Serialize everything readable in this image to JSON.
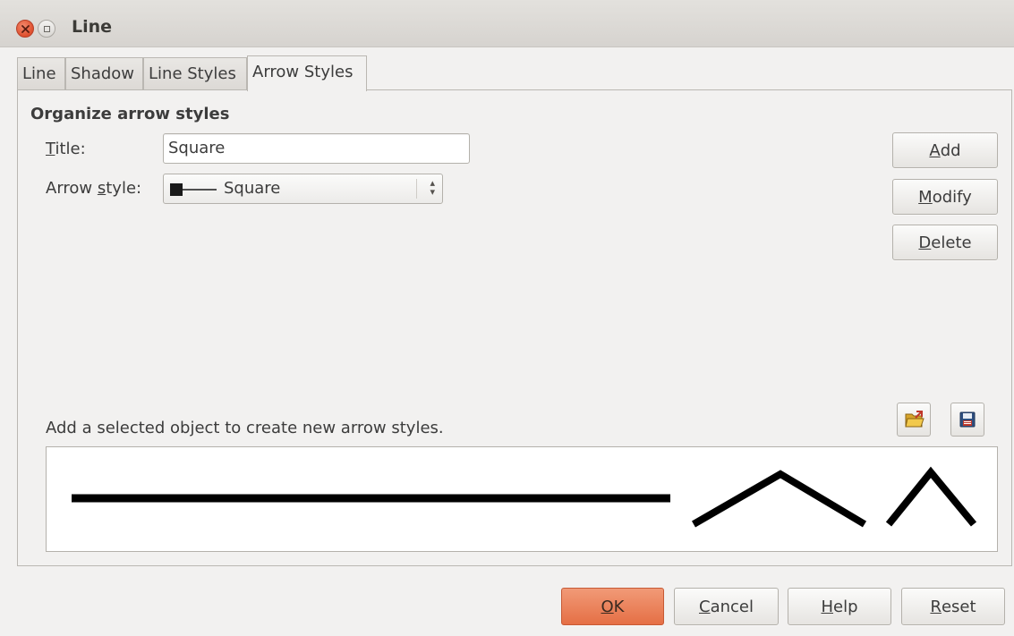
{
  "window": {
    "title": "Line"
  },
  "tabs": [
    {
      "label": "Line",
      "active": false
    },
    {
      "label": "Shadow",
      "active": false
    },
    {
      "label": "Line Styles",
      "active": false
    },
    {
      "label": "Arrow Styles",
      "active": true
    }
  ],
  "section": {
    "title": "Organize arrow styles"
  },
  "form": {
    "title_label_mnemonic": "T",
    "title_label_rest": "itle:",
    "title_value": "Square",
    "arrow_label_pre": "Arrow ",
    "arrow_label_mnemonic": "s",
    "arrow_label_rest": "tyle:",
    "arrow_style_selected": "Square"
  },
  "side_buttons": {
    "add_mnemonic": "A",
    "add_rest": "dd",
    "modify_mnemonic": "M",
    "modify_rest": "odify",
    "delete_mnemonic": "D",
    "delete_rest": "elete"
  },
  "hint_text": "Add a selected object to create new arrow styles.",
  "icons": {
    "load": "open-folder-icon",
    "save": "save-disk-icon"
  },
  "footer": {
    "ok_mnemonic": "O",
    "ok_rest": "K",
    "cancel_mnemonic": "C",
    "cancel_rest": "ancel",
    "help_mnemonic": "H",
    "help_rest": "elp",
    "reset_mnemonic": "R",
    "reset_rest": "eset"
  },
  "colors": {
    "ok_button": "#e56f45",
    "close_button": "#de4f2d"
  }
}
